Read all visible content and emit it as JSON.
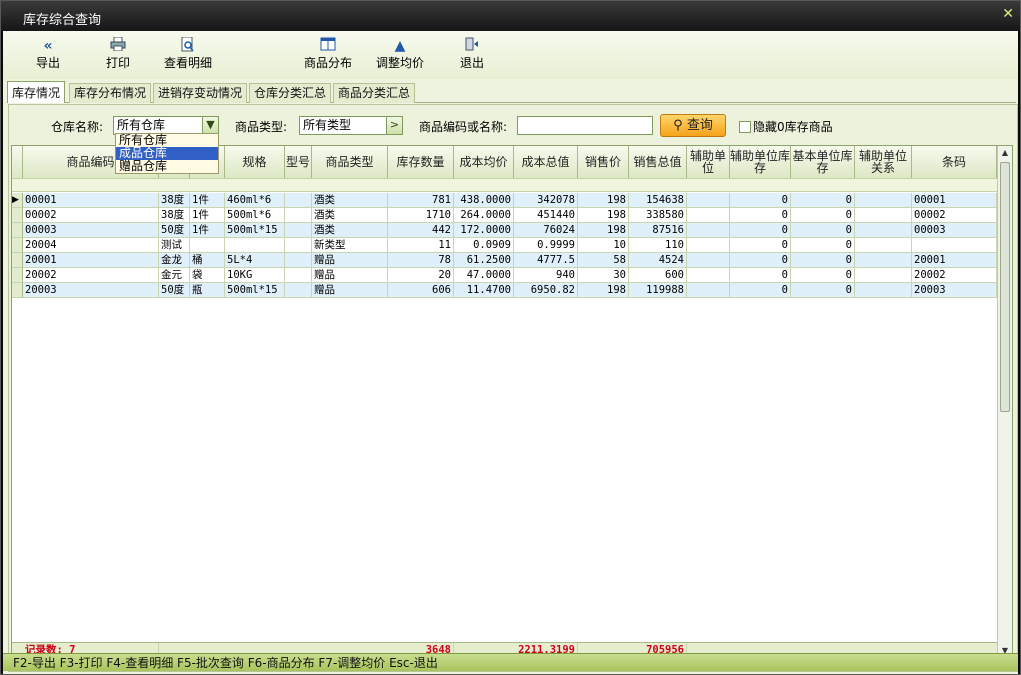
{
  "window": {
    "title": "库存综合查询"
  },
  "toolbar": {
    "export": "导出",
    "print": "打印",
    "detail": "查看明细",
    "distribution": "商品分布",
    "adjust": "调整均价",
    "exit": "退出"
  },
  "tabs": [
    "库存情况",
    "库存分布情况",
    "进销存变动情况",
    "仓库分类汇总",
    "商品分类汇总"
  ],
  "filter": {
    "warehouse_label": "仓库名称:",
    "warehouse_value": "所有仓库",
    "type_label": "商品类型:",
    "type_value": "所有类型",
    "code_label": "商品编码或名称:",
    "code_value": "",
    "query_button": "查询",
    "hide_zero_label": "隐藏0库存商品"
  },
  "dropdown": {
    "options": [
      "所有仓库",
      "成品仓库",
      "赠品仓库"
    ],
    "selected_index": 1
  },
  "table": {
    "columns": [
      "商品编码",
      "",
      "",
      "规格",
      "型号",
      "商品类型",
      "库存数量",
      "成本均价",
      "成本总值",
      "销售价",
      "销售总值",
      "辅助单位",
      "辅助单位库存",
      "基本单位库存",
      "辅助单位关系",
      "条码"
    ],
    "rows": [
      [
        "00001",
        "38度",
        "1件",
        "460ml*6",
        "",
        "酒类",
        "781",
        "438.0000",
        "342078",
        "198",
        "154638",
        "",
        "0",
        "0",
        "",
        "00001"
      ],
      [
        "00002",
        "38度",
        "1件",
        "500ml*6",
        "",
        "酒类",
        "1710",
        "264.0000",
        "451440",
        "198",
        "338580",
        "",
        "0",
        "0",
        "",
        "00002"
      ],
      [
        "00003",
        "50度",
        "1件",
        "500ml*15",
        "",
        "酒类",
        "442",
        "172.0000",
        "76024",
        "198",
        "87516",
        "",
        "0",
        "0",
        "",
        "00003"
      ],
      [
        "20004",
        "测试",
        "",
        "",
        "",
        "新类型",
        "11",
        "0.0909",
        "0.9999",
        "10",
        "110",
        "",
        "0",
        "0",
        "",
        ""
      ],
      [
        "20001",
        "金龙",
        "桶",
        "5L*4",
        "",
        "赠品",
        "78",
        "61.2500",
        "4777.5",
        "58",
        "4524",
        "",
        "0",
        "0",
        "",
        "20001"
      ],
      [
        "20002",
        "金元",
        "袋",
        "10KG",
        "",
        "赠品",
        "20",
        "47.0000",
        "940",
        "30",
        "600",
        "",
        "0",
        "0",
        "",
        "20002"
      ],
      [
        "20003",
        "50度",
        "瓶",
        "500ml*15",
        "",
        "赠品",
        "606",
        "11.4700",
        "6950.82",
        "198",
        "119988",
        "",
        "0",
        "0",
        "",
        "20003"
      ]
    ],
    "footer": {
      "record_count": "记录数: 7",
      "qty_total": "3648",
      "cost_total": "2211.3199",
      "sale_total": "705956"
    }
  },
  "statusbar": {
    "text": "F2-导出 F3-打印 F4-查看明细 F5-批次查询 F6-商品分布 F7-调整均价 Esc-退出"
  },
  "colors": {
    "accent": "#3160c4",
    "total_red": "#d0021b",
    "status_green": "#a8c45c"
  }
}
